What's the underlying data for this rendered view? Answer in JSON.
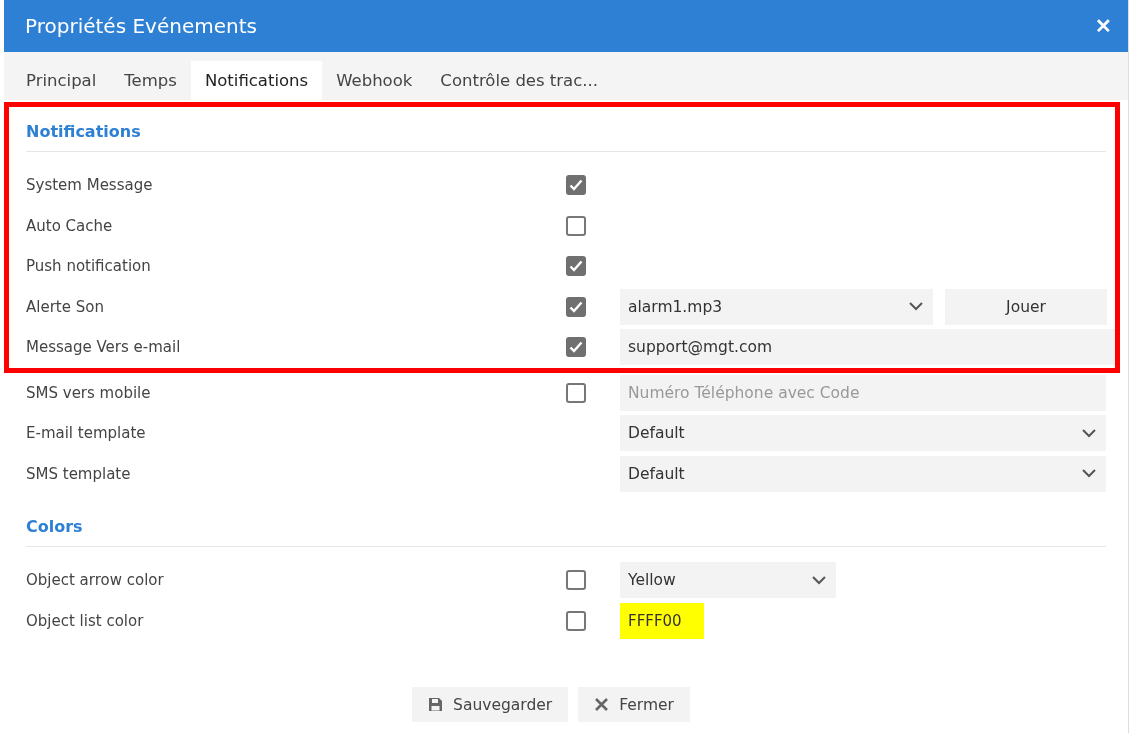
{
  "window": {
    "title": "Propriétés Evénements",
    "close": "✕"
  },
  "tabs": [
    {
      "label": "Principal",
      "selected": false
    },
    {
      "label": "Temps",
      "selected": false
    },
    {
      "label": "Notifications",
      "selected": true
    },
    {
      "label": "Webhook",
      "selected": false
    },
    {
      "label": "Contrôle des trac...",
      "selected": false
    }
  ],
  "sections": [
    {
      "title": "Notifications",
      "rows": [
        {
          "kind": "check",
          "label": "System Message",
          "checked": true,
          "highlighted": true
        },
        {
          "kind": "check",
          "label": "Auto Cache",
          "checked": false,
          "highlighted": true
        },
        {
          "kind": "check",
          "label": "Push notification",
          "checked": true,
          "highlighted": true
        },
        {
          "kind": "check-select-button",
          "label": "Alerte Son",
          "checked": true,
          "value": "alarm1.mp3",
          "button": "Jouer",
          "highlighted": true
        },
        {
          "kind": "check-input",
          "label": "Message Vers e-mail",
          "checked": true,
          "value": "support@mgt.com",
          "highlighted": true
        },
        {
          "kind": "check-input",
          "label": "SMS vers mobile",
          "checked": false,
          "placeholder": "Numéro Téléphone avec Code",
          "highlighted": false
        },
        {
          "kind": "select",
          "label": "E-mail template",
          "value": "Default",
          "highlighted": false
        },
        {
          "kind": "select",
          "label": "SMS template",
          "value": "Default",
          "highlighted": false
        }
      ]
    },
    {
      "title": "Colors",
      "rows": [
        {
          "kind": "check-short-select",
          "label": "Object arrow color",
          "checked": false,
          "value": "Yellow",
          "highlighted": false
        },
        {
          "kind": "check-swatch",
          "label": "Object list color",
          "checked": false,
          "value": "FFFF00",
          "color": "#ffff00",
          "highlighted": false
        }
      ]
    }
  ],
  "buttons": [
    {
      "kind": "save",
      "label": "Sauvegarder"
    },
    {
      "kind": "close",
      "label": "Fermer"
    }
  ]
}
